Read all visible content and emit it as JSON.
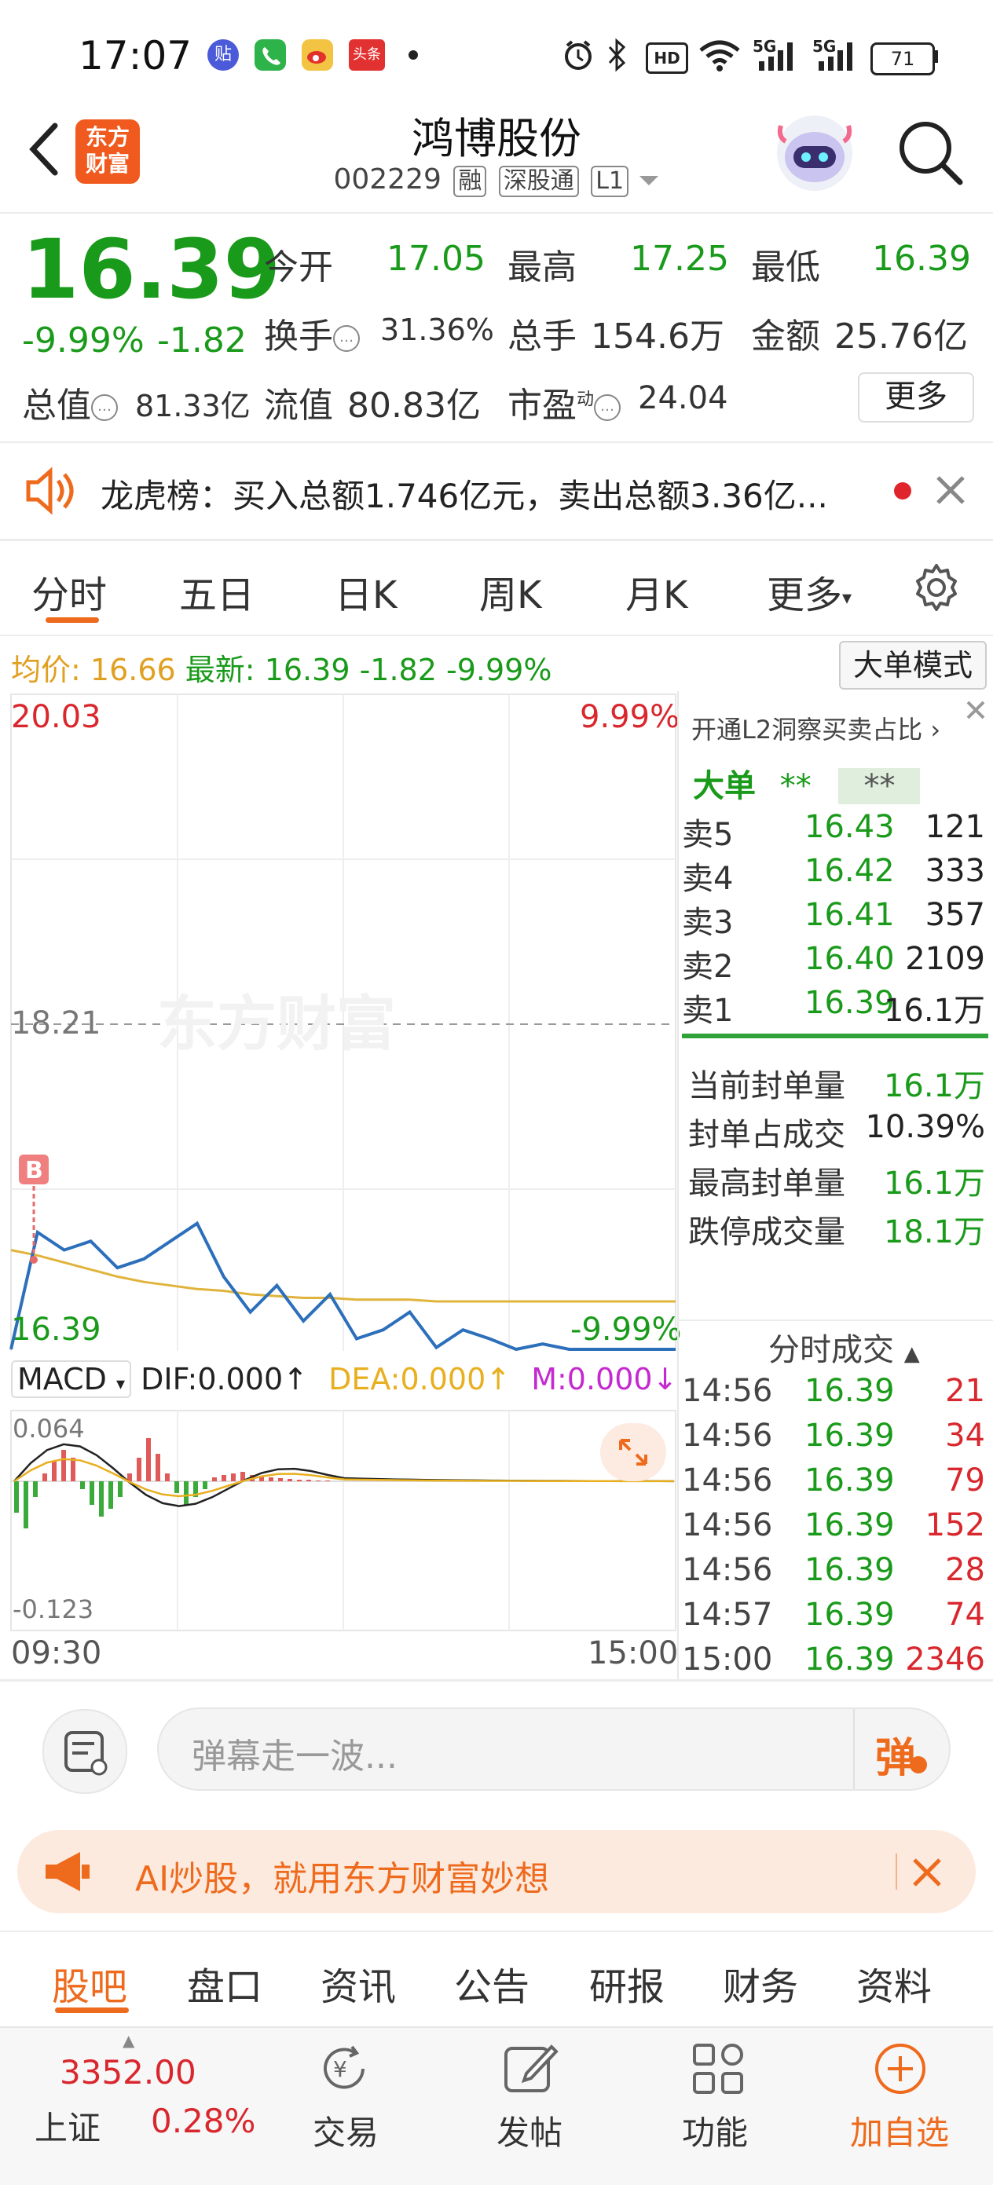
{
  "status_bar": {
    "time": "17:07",
    "battery": "71",
    "icons": [
      "tieba-icon",
      "phone-icon",
      "weibo-icon",
      "toutiao-icon",
      "alarm-icon",
      "bluetooth-icon",
      "hd-icon",
      "wifi-icon",
      "signal-5g-icon",
      "signal-5g-icon",
      "battery-icon"
    ],
    "toutiao_label": "头条",
    "tieba_label": "贴",
    "hd_label": "HD"
  },
  "header": {
    "app_logo": "东方\n财富",
    "logo_line1": "东方",
    "logo_line2": "财富",
    "title": "鸿博股份",
    "code": "002229",
    "tags": [
      "融",
      "深股通",
      "L1"
    ]
  },
  "quote": {
    "price": "16.39",
    "change_pct": "-9.99%",
    "change": "-1.82",
    "labels": {
      "open": "今开",
      "high": "最高",
      "low": "最低",
      "turnover": "换手",
      "volume": "总手",
      "amount": "金额",
      "mktcap": "总值",
      "float": "流值",
      "pe": "市盈",
      "pe_sup": "动"
    },
    "values": {
      "open": "17.05",
      "high": "17.25",
      "low": "16.39",
      "turnover": "31.36%",
      "volume": "154.6万",
      "amount": "25.76亿",
      "mktcap": "81.33亿",
      "float": "80.83亿",
      "pe": "24.04"
    },
    "more": "更多"
  },
  "notice": {
    "text": "龙虎榜：买入总额1.746亿元，卖出总额3.36亿..."
  },
  "chart_tabs": [
    "分时",
    "五日",
    "日K",
    "周K",
    "月K",
    "更多"
  ],
  "avg_bar": {
    "avg_label": "均价:",
    "avg": "16.66",
    "latest_label": "最新:",
    "latest": "16.39",
    "chg": "-1.82",
    "pct": "-9.99%",
    "big_order_btn": "大单模式"
  },
  "chart_labels": {
    "top_price": "20.03",
    "top_pct": "9.99%",
    "mid_price": "18.21",
    "bottom_price": "16.39",
    "bottom_pct": "-9.99%",
    "watermark": "东方财富",
    "time_start": "09:30",
    "time_end": "15:00",
    "buy_marker": "B"
  },
  "macd": {
    "label": "MACD",
    "dif": "DIF:0.000",
    "dea": "DEA:0.000",
    "m": "M:0.000",
    "top": "0.064",
    "bottom": "-0.123"
  },
  "order_book": {
    "promo": "开通L2洞察买卖占比",
    "big_label": "大单",
    "big_val1": "**",
    "big_val2": "**",
    "asks": [
      {
        "label": "卖5",
        "price": "16.43",
        "vol": "121"
      },
      {
        "label": "卖4",
        "price": "16.42",
        "vol": "333"
      },
      {
        "label": "卖3",
        "price": "16.41",
        "vol": "357"
      },
      {
        "label": "卖2",
        "price": "16.40",
        "vol": "2109"
      },
      {
        "label": "卖1",
        "price": "16.39",
        "vol": "16.1万"
      }
    ],
    "stats": [
      {
        "label": "当前封单量",
        "value": "16.1万"
      },
      {
        "label": "封单占成交",
        "value": "10.39%"
      },
      {
        "label": "最高封单量",
        "value": "16.1万"
      },
      {
        "label": "跌停成交量",
        "value": "18.1万"
      }
    ],
    "ticks_title": "分时成交",
    "ticks": [
      {
        "t": "14:56",
        "p": "16.39",
        "v": "21"
      },
      {
        "t": "14:56",
        "p": "16.39",
        "v": "34"
      },
      {
        "t": "14:56",
        "p": "16.39",
        "v": "79"
      },
      {
        "t": "14:56",
        "p": "16.39",
        "v": "152"
      },
      {
        "t": "14:56",
        "p": "16.39",
        "v": "28"
      },
      {
        "t": "14:57",
        "p": "16.39",
        "v": "74"
      },
      {
        "t": "15:00",
        "p": "16.39",
        "v": "2346"
      }
    ]
  },
  "comment": {
    "placeholder": "弹幕走一波...",
    "danmu": "弹"
  },
  "ad": {
    "text": "AI炒股，就用东方财富妙想"
  },
  "section_tabs": [
    "股吧",
    "盘口",
    "资讯",
    "公告",
    "研报",
    "财务",
    "资料"
  ],
  "bottom_nav": {
    "index_value": "3352.00",
    "index_name": "上证",
    "index_pct": "0.28%",
    "items": [
      "交易",
      "发帖",
      "功能",
      "加自选"
    ]
  },
  "colors": {
    "up": "#d9272e",
    "down": "#1a9a1a",
    "accent": "#ee6a1c",
    "price_line": "#2c6fbb",
    "avg_line": "#e0b43c"
  },
  "chart_data": {
    "type": "line",
    "title": "",
    "x": [
      "09:30",
      "15:00"
    ],
    "y_range": [
      16.39,
      20.03
    ],
    "prev_close": "18.21",
    "series": [
      {
        "values": [
          16.39,
          17.05,
          16.95,
          17.0,
          16.85,
          16.9,
          17.0,
          17.1,
          16.8,
          16.6,
          16.75,
          16.55,
          16.7,
          16.45,
          16.5,
          16.6,
          16.4,
          16.5,
          16.45,
          16.39,
          16.42,
          16.39,
          16.39,
          16.39,
          16.39,
          16.39
        ]
      },
      {
        "values": [
          16.95,
          16.92,
          16.88,
          16.84,
          16.8,
          16.77,
          16.75,
          16.73,
          16.72,
          16.7,
          16.69,
          16.68,
          16.68,
          16.67,
          16.67,
          16.67,
          16.66,
          16.66,
          16.66,
          16.66,
          16.66,
          16.66,
          16.66,
          16.66,
          16.66,
          16.66
        ]
      }
    ],
    "ylabel": "",
    "xlabel": "",
    "grid": true
  }
}
